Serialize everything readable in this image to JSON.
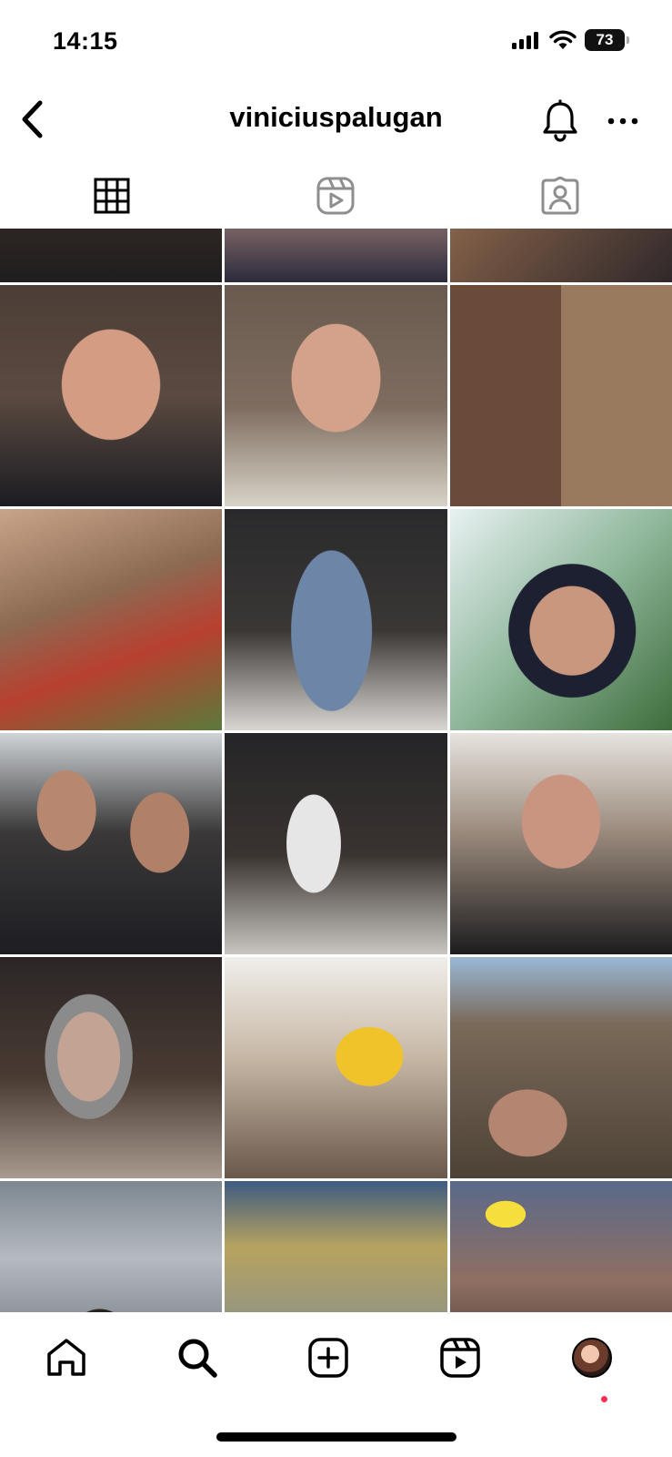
{
  "status_bar": {
    "time": "14:15",
    "battery_level": "73",
    "icons": [
      "cellular-signal-icon",
      "wifi-icon",
      "battery-icon"
    ]
  },
  "header": {
    "username": "viniciuspalugan",
    "icons": [
      "back-chevron-icon",
      "bell-icon",
      "more-dots-icon"
    ]
  },
  "tabs": [
    {
      "name": "posts-grid",
      "icon": "grid-icon",
      "selected": true
    },
    {
      "name": "reels",
      "icon": "reels-icon",
      "selected": false
    },
    {
      "name": "tagged",
      "icon": "tagged-person-icon",
      "selected": false
    }
  ],
  "bottom_nav": {
    "items": [
      "home-icon",
      "search-icon",
      "create-post-icon",
      "reels-icon",
      "profile-avatar"
    ],
    "profile_has_notification": true
  },
  "colors": {
    "text": "#000000",
    "background": "#ffffff",
    "notification_dot": "#ff2d55",
    "icon_inactive": "#8e8e8e"
  }
}
